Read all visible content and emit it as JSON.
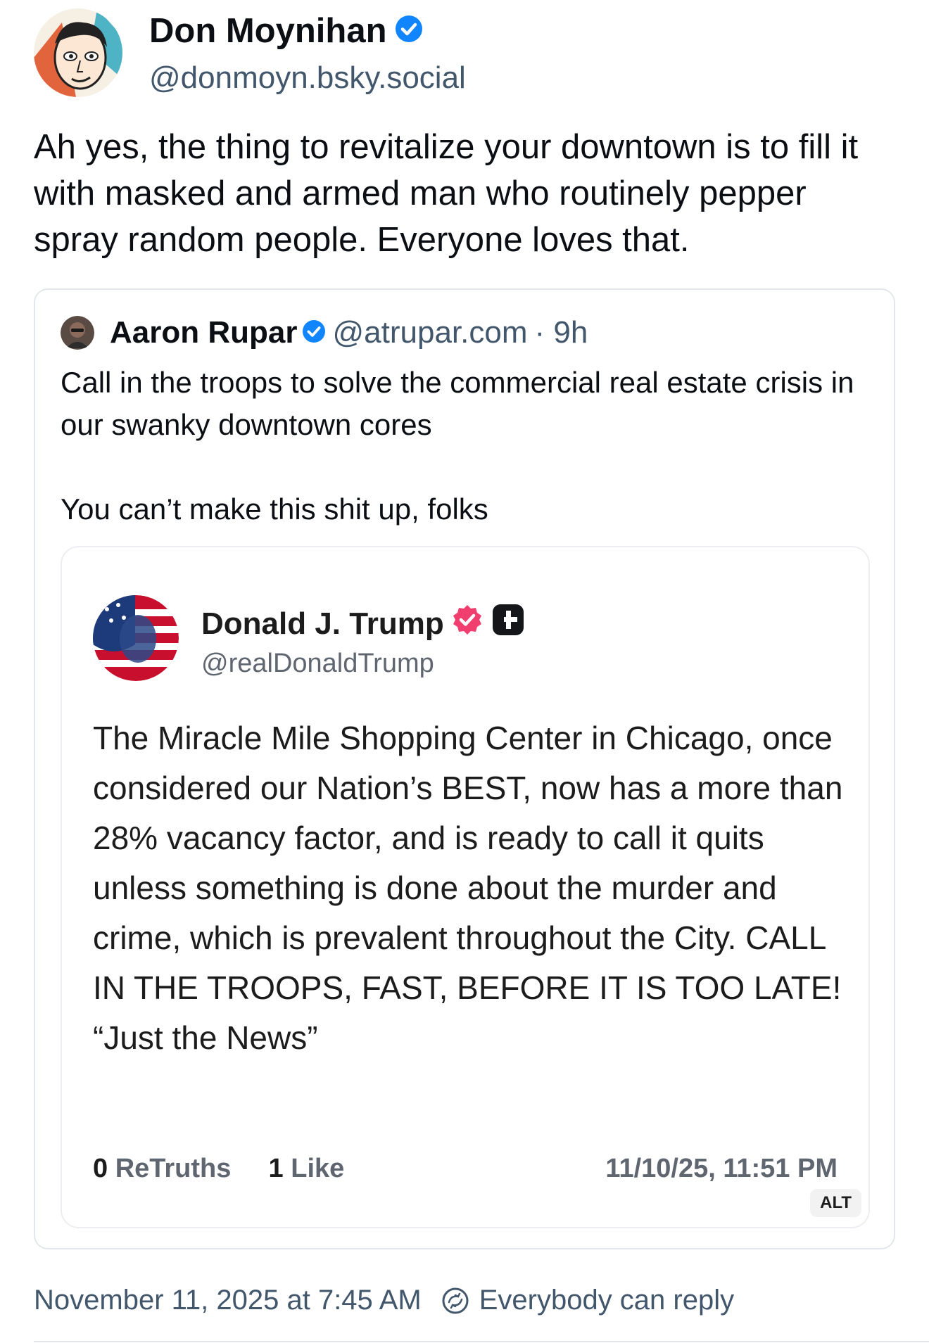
{
  "post": {
    "author_name": "Don Moynihan",
    "author_handle": "@donmoyn.bsky.social",
    "text": "Ah yes, the thing to revitalize your downtown is to fill it with masked and armed man who routinely pepper spray random people. Everyone loves that.",
    "timestamp": "November 11, 2025 at 7:45 AM",
    "reply_setting": "Everybody can reply",
    "verified_color": "#1185fe"
  },
  "quote": {
    "author_name": "Aaron Rupar",
    "author_handle": "@atrupar.com",
    "age": "· 9h",
    "text": "Call in the troops to solve the commercial real estate crisis in our swanky downtown cores\n\nYou can’t make this shit up, folks"
  },
  "embedded": {
    "author_name": "Donald J. Trump",
    "author_handle": "@realDonaldTrump",
    "text": "The Miracle Mile Shopping Center in Chicago, once considered our Nation’s BEST, now has a more than 28% vacancy factor, and is ready to call it quits unless something is done about the murder and crime, which is prevalent throughout the City. CALL IN THE TROOPS, FAST, BEFORE IT IS TOO LATE! “Just the News”",
    "retruths_count": "0",
    "retruths_label": "ReTruths",
    "likes_count": "1",
    "likes_label": "Like",
    "datetime": "11/10/25, 11:51 PM",
    "alt_label": "ALT",
    "verified_color": "#f03e6e"
  }
}
